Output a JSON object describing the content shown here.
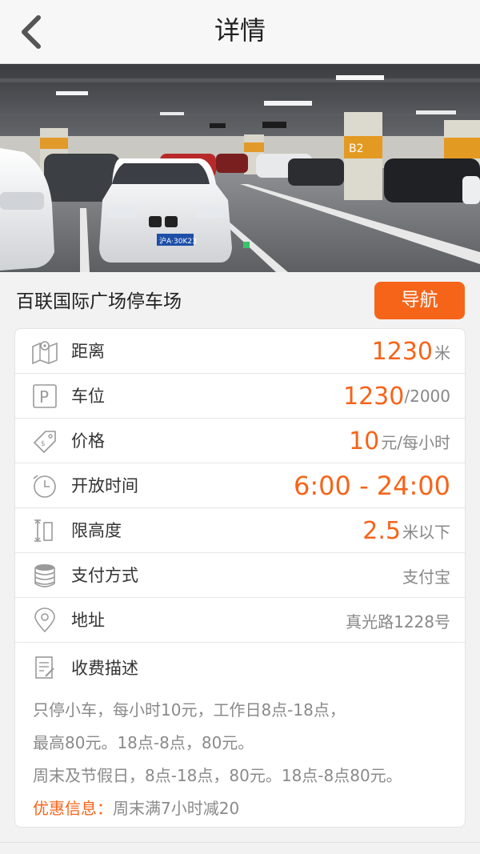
{
  "header": {
    "title": "详情",
    "back_icon": "chevron-left-icon"
  },
  "parking_lot": {
    "name": "百联国际广场停车场",
    "navigate_label": "导航",
    "photo_plate_text": "沪A·30K23"
  },
  "details": {
    "distance": {
      "label": "距离",
      "value": "1230",
      "unit": "米",
      "icon": "map-icon"
    },
    "spaces": {
      "label": "车位",
      "available": "1230",
      "total": "/2000",
      "icon": "parking-icon"
    },
    "price": {
      "label": "价格",
      "value": "10",
      "unit": "元/每小时",
      "icon": "price-tag-icon"
    },
    "hours": {
      "label": "开放时间",
      "value": "6:00 - 24:00",
      "icon": "clock-icon"
    },
    "height_limit": {
      "label": "限高度",
      "value": "2.5",
      "unit": "米以下",
      "icon": "height-limit-icon"
    },
    "payment": {
      "label": "支付方式",
      "value": "支付宝",
      "icon": "coins-icon"
    },
    "address": {
      "label": "地址",
      "value": "真光路1228号",
      "icon": "location-pin-icon"
    }
  },
  "fee_description": {
    "label": "收费描述",
    "icon": "note-edit-icon",
    "lines": [
      "只停小车，每小时10元，工作日8点-18点，",
      "最高80元。18点-8点，80元。",
      "周末及节假日，8点-18点，80元。18点-8点80元。"
    ],
    "promo_label": "优惠信息：",
    "promo_text": "周末满7小时减20"
  },
  "colors": {
    "accent": "#f6641a",
    "text_gray": "#888888"
  }
}
